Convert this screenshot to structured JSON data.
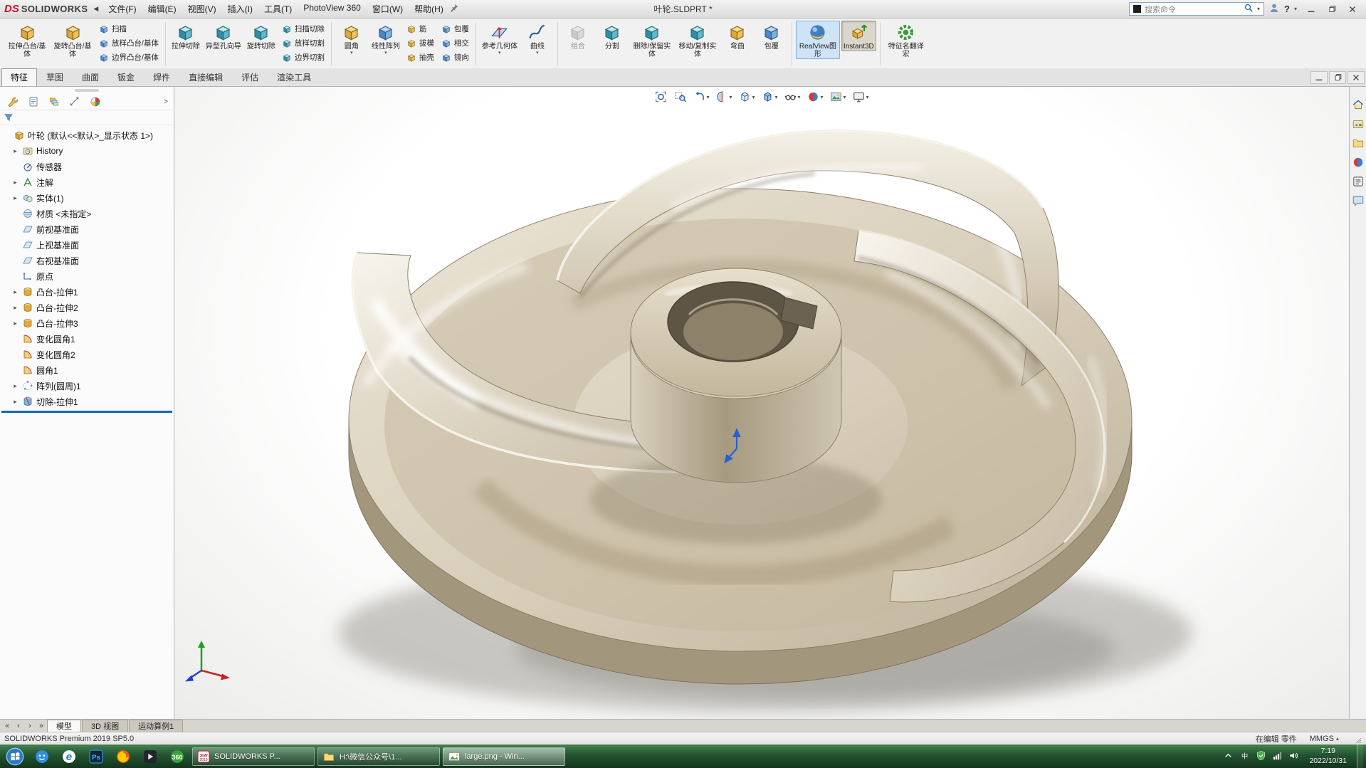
{
  "titlebar": {
    "logo_ds": "DS",
    "logo_text": "SOLIDWORKS",
    "menus": [
      "文件(F)",
      "编辑(E)",
      "视图(V)",
      "插入(I)",
      "工具(T)",
      "PhotoView 360",
      "窗口(W)",
      "帮助(H)"
    ],
    "title": "叶轮.SLDPRT *",
    "search_placeholder": "搜索命令",
    "window_controls": [
      "minimize",
      "restore",
      "close"
    ]
  },
  "ribbon": {
    "groups": [
      {
        "items": [
          {
            "type": "large",
            "label": "拉伸凸台/基体",
            "icon": "gold"
          },
          {
            "type": "large",
            "label": "旋转凸台/基体",
            "icon": "gold"
          },
          {
            "type": "stack",
            "buttons": [
              {
                "label": "扫描",
                "icon": "blue"
              },
              {
                "label": "放样凸台/基体",
                "icon": "blue"
              },
              {
                "label": "边界凸台/基体",
                "icon": "blue"
              }
            ]
          }
        ]
      },
      {
        "items": [
          {
            "type": "large",
            "label": "拉伸切除",
            "icon": "teal"
          },
          {
            "type": "large",
            "label": "异型孔向导",
            "icon": "teal"
          },
          {
            "type": "large",
            "label": "旋转切除",
            "icon": "teal"
          },
          {
            "type": "stack",
            "buttons": [
              {
                "label": "扫描切除",
                "icon": "teal"
              },
              {
                "label": "放样切割",
                "icon": "teal"
              },
              {
                "label": "边界切割",
                "icon": "teal"
              }
            ]
          }
        ]
      },
      {
        "items": [
          {
            "type": "large",
            "label": "圆角",
            "icon": "gold",
            "caret": true
          },
          {
            "type": "large",
            "label": "线性阵列",
            "icon": "blue",
            "caret": true
          },
          {
            "type": "stack",
            "buttons": [
              {
                "label": "筋",
                "icon": "gold"
              },
              {
                "label": "拔模",
                "icon": "gold"
              },
              {
                "label": "抽壳",
                "icon": "gold"
              }
            ]
          },
          {
            "type": "stack",
            "buttons": [
              {
                "label": "包覆",
                "icon": "blue"
              },
              {
                "label": "相交",
                "icon": "blue"
              },
              {
                "label": "镜向",
                "icon": "blue"
              }
            ]
          }
        ]
      },
      {
        "items": [
          {
            "type": "large",
            "label": "参考几何体",
            "icon": "ref",
            "caret": true
          },
          {
            "type": "large",
            "label": "曲线",
            "icon": "curve",
            "caret": true
          }
        ]
      },
      {
        "items": [
          {
            "type": "large",
            "label": "组合",
            "icon": "gray",
            "disabled": true
          },
          {
            "type": "large",
            "label": "分割",
            "icon": "teal"
          },
          {
            "type": "large",
            "label": "删除/保留实体",
            "icon": "teal"
          },
          {
            "type": "large",
            "label": "移动/复制实体",
            "icon": "teal"
          },
          {
            "type": "large",
            "label": "弯曲",
            "icon": "gold"
          },
          {
            "type": "large",
            "label": "包覆",
            "icon": "blue"
          }
        ]
      },
      {
        "items": [
          {
            "type": "large",
            "label": "RealView图形",
            "icon": "sphere",
            "state": "highlight"
          },
          {
            "type": "large",
            "label": "Instant3D",
            "icon": "instant",
            "state": "pressed"
          }
        ]
      },
      {
        "items": [
          {
            "type": "large",
            "label": "特征名翻译宏",
            "icon": "gear-green"
          }
        ]
      }
    ]
  },
  "command_tabs": [
    {
      "label": "特征",
      "active": true
    },
    {
      "label": "草图"
    },
    {
      "label": "曲面"
    },
    {
      "label": "钣金"
    },
    {
      "label": "焊件"
    },
    {
      "label": "直接编辑"
    },
    {
      "label": "评估"
    },
    {
      "label": "渲染工具"
    }
  ],
  "doc_window_controls": [
    "minimize",
    "restore",
    "close"
  ],
  "headsup": [
    {
      "icon": "zoom-fit"
    },
    {
      "icon": "zoom-area"
    },
    {
      "icon": "previous-view",
      "caret": true
    },
    {
      "icon": "section-view",
      "caret": true
    },
    {
      "icon": "view-orientation",
      "caret": true
    },
    {
      "icon": "display-style",
      "caret": true
    },
    {
      "icon": "hide-show-items",
      "caret": true
    },
    {
      "icon": "edit-appearance",
      "caret": true
    },
    {
      "icon": "apply-scene",
      "caret": true
    },
    {
      "icon": "view-settings",
      "caret": true
    }
  ],
  "left_panel": {
    "tabs": [
      "featuremanager",
      "propertymanager",
      "configurationmanager",
      "dimxpertmanager",
      "displaymanager"
    ],
    "tree": {
      "root": {
        "label": "叶轮 (默认<<默认>_显示状态 1>)",
        "icon": "part"
      },
      "items": [
        {
          "label": "History",
          "icon": "history",
          "arrow": true
        },
        {
          "label": "传感器",
          "icon": "sensors",
          "arrow": false
        },
        {
          "label": "注解",
          "icon": "annotations",
          "arrow": true
        },
        {
          "label": "实体(1)",
          "icon": "bodies",
          "arrow": true
        },
        {
          "label": "材质 <未指定>",
          "icon": "material",
          "arrow": false
        },
        {
          "label": "前视基准面",
          "icon": "plane",
          "arrow": false
        },
        {
          "label": "上视基准面",
          "icon": "plane",
          "arrow": false
        },
        {
          "label": "右视基准面",
          "icon": "plane",
          "arrow": false
        },
        {
          "label": "原点",
          "icon": "origin",
          "arrow": false
        },
        {
          "label": "凸台-拉伸1",
          "icon": "boss",
          "arrow": true
        },
        {
          "label": "凸台-拉伸2",
          "icon": "boss",
          "arrow": true
        },
        {
          "label": "凸台-拉伸3",
          "icon": "boss",
          "arrow": true
        },
        {
          "label": "变化圆角1",
          "icon": "fillet",
          "arrow": false
        },
        {
          "label": "变化圆角2",
          "icon": "fillet",
          "arrow": false
        },
        {
          "label": "圆角1",
          "icon": "fillet",
          "arrow": false
        },
        {
          "label": "阵列(圆周)1",
          "icon": "pattern",
          "arrow": true
        },
        {
          "label": "切除-拉伸1",
          "icon": "cut",
          "arrow": true
        }
      ]
    }
  },
  "task_pane_icons": [
    "resources",
    "design-library",
    "file-explorer",
    "appearances",
    "custom-properties",
    "forum"
  ],
  "bottom_bar": {
    "nav": [
      "first",
      "prev",
      "next",
      "last"
    ],
    "tabs": [
      {
        "label": "模型",
        "active": true
      },
      {
        "label": "3D 视图"
      },
      {
        "label": "运动算例1"
      }
    ]
  },
  "statusbar": {
    "left": "SOLIDWORKS Premium 2019 SP5.0",
    "editing": "在编辑 零件",
    "units": "MMGS"
  },
  "taskbar": {
    "quick_icons": [
      "start",
      "blue-app",
      "edge",
      "photoshop",
      "firefox",
      "dark-app",
      "app-360"
    ],
    "windows": [
      {
        "icon": "solidworks",
        "label": "SOLIDWORKS P..."
      },
      {
        "icon": "folder",
        "label": "H:\\微信公众号\\1..."
      },
      {
        "icon": "image-viewer",
        "label": "large.png - Win...",
        "active": true
      }
    ],
    "tray_icons": [
      "tray-expand",
      "ime",
      "shield",
      "network",
      "volume"
    ],
    "clock": {
      "time": "7:19",
      "date": "2022/10/31"
    }
  }
}
